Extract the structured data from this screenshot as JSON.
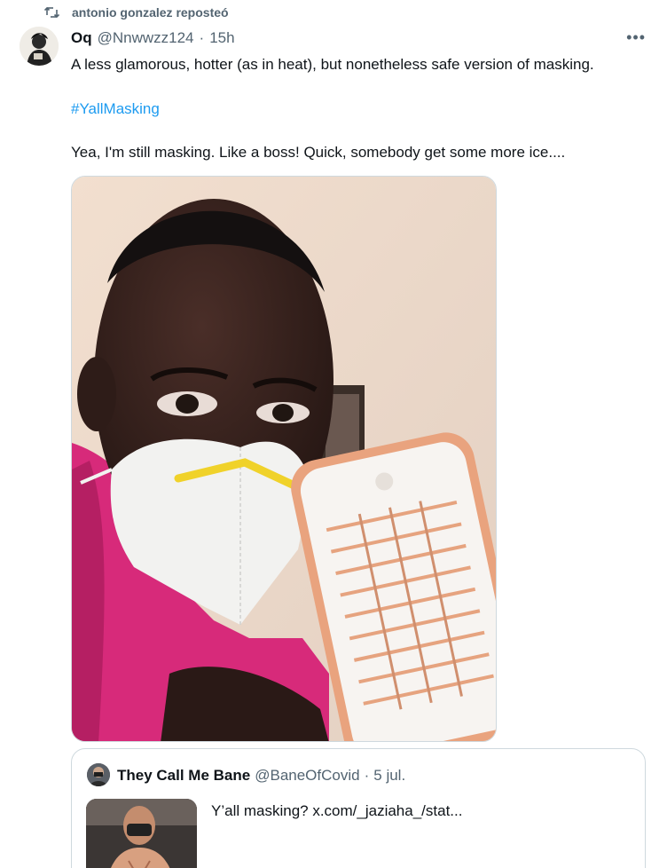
{
  "repost": {
    "text": "antonio gonzalez reposteó",
    "icon": "repost-icon"
  },
  "tweet": {
    "avatar_icon": "avatar",
    "name": "Oq",
    "handle": "@Nnwwzz124",
    "separator": "·",
    "time": "15h",
    "more_label": "•••",
    "line1": "A less glamorous, hotter (as in heat), but nonetheless safe version of masking.",
    "hashtag": "#YallMasking",
    "line3": "Yea, I'm still masking. Like a boss! Quick, somebody get some more ice....",
    "hashtag_color": "#1d9bf0"
  },
  "quote": {
    "name": "They Call Me Bane",
    "handle": "@BaneOfCovid",
    "separator": "·",
    "date": "5 jul.",
    "text": "Y’all masking?  x.com/_jaziaha_/stat..."
  }
}
